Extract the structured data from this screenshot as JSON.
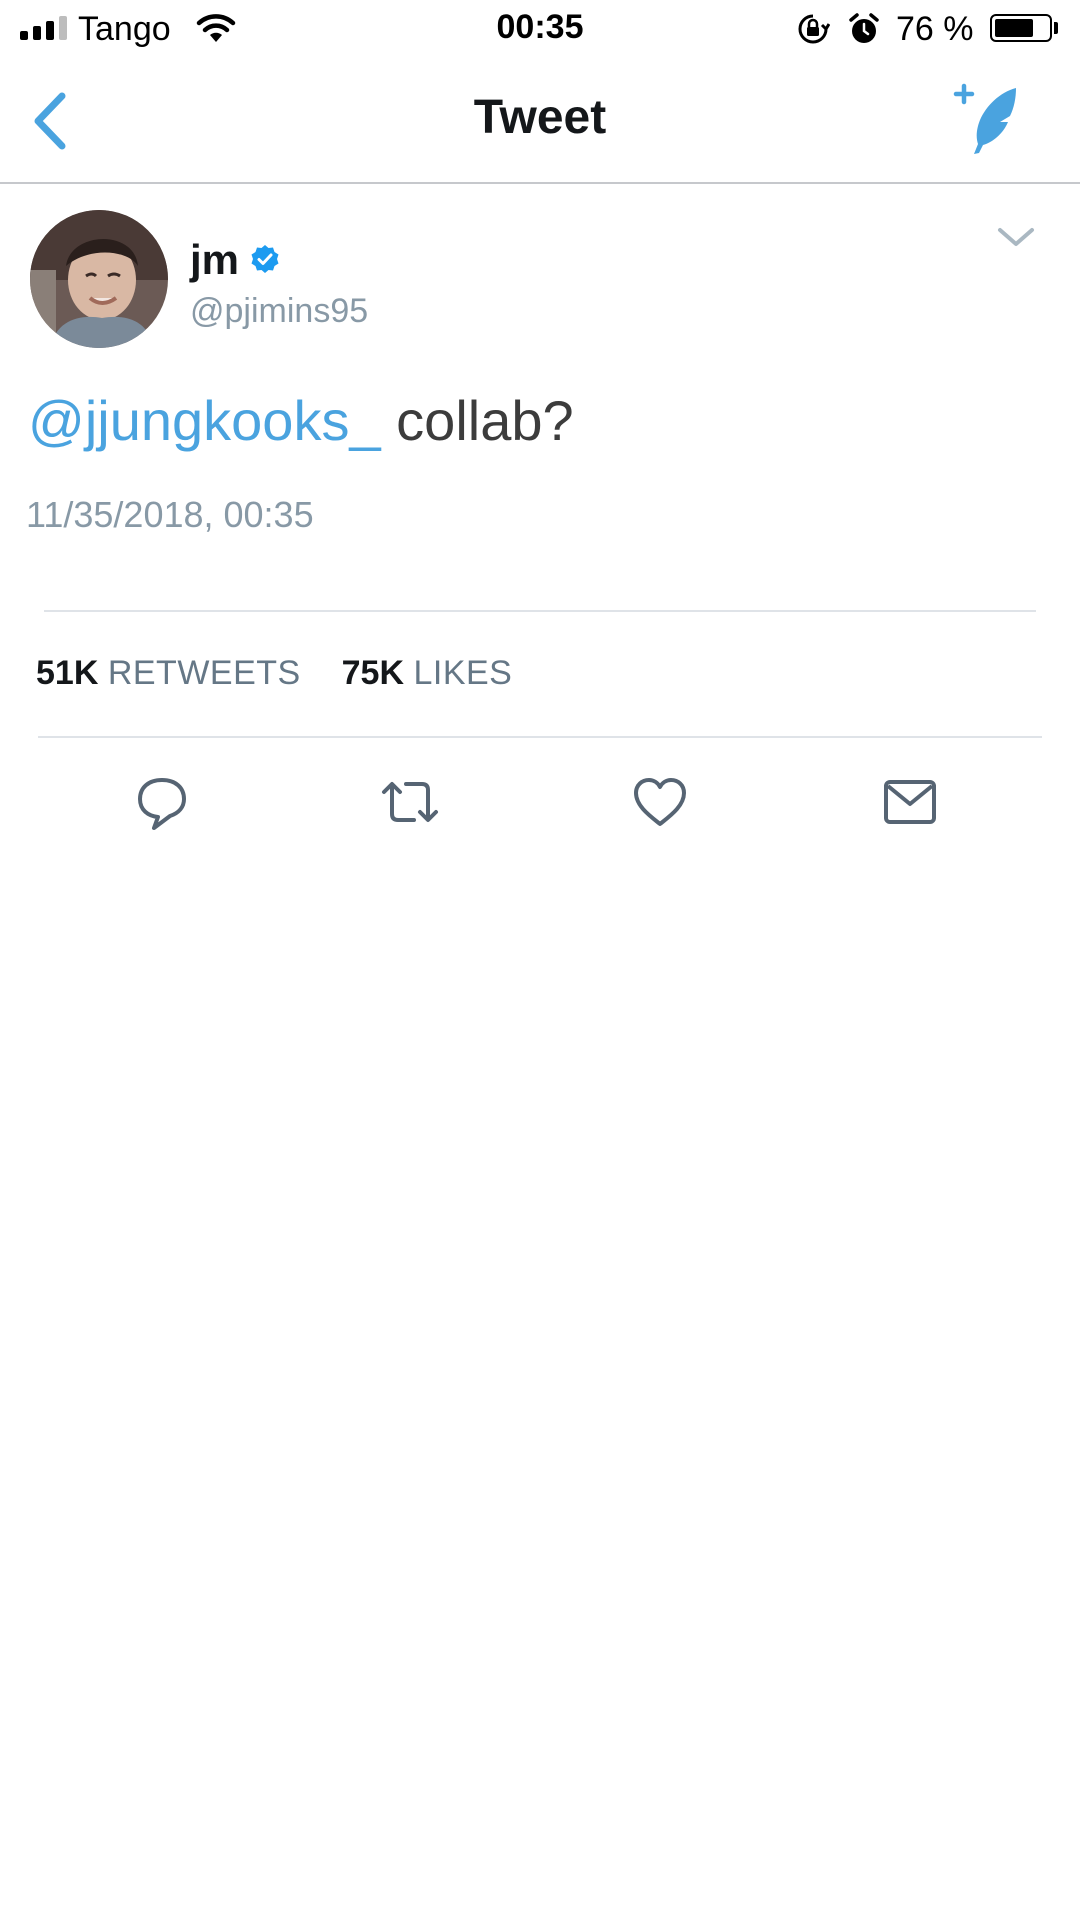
{
  "status_bar": {
    "carrier": "Tango",
    "time": "00:35",
    "battery_percent_label": "76 %",
    "battery_level": 0.76
  },
  "nav": {
    "title": "Tweet"
  },
  "tweet": {
    "display_name": "jm",
    "username": "@pjimins95",
    "mention": "@jjungkooks_",
    "text": " collab?",
    "timestamp": "11/35/2018, 00:35",
    "retweets_count": "51K",
    "retweets_label": "RETWEETS",
    "likes_count": "75K",
    "likes_label": "LIKES"
  },
  "colors": {
    "accent": "#4aa3df",
    "secondary_text": "#8899a6",
    "action_icon": "#566473"
  },
  "icons": {
    "back": "chevron-left-icon",
    "compose": "compose-tweet-icon",
    "verified": "verified-badge-icon",
    "more": "chevron-down-icon",
    "reply": "reply-icon",
    "retweet": "retweet-icon",
    "like": "heart-icon",
    "share": "envelope-icon"
  }
}
